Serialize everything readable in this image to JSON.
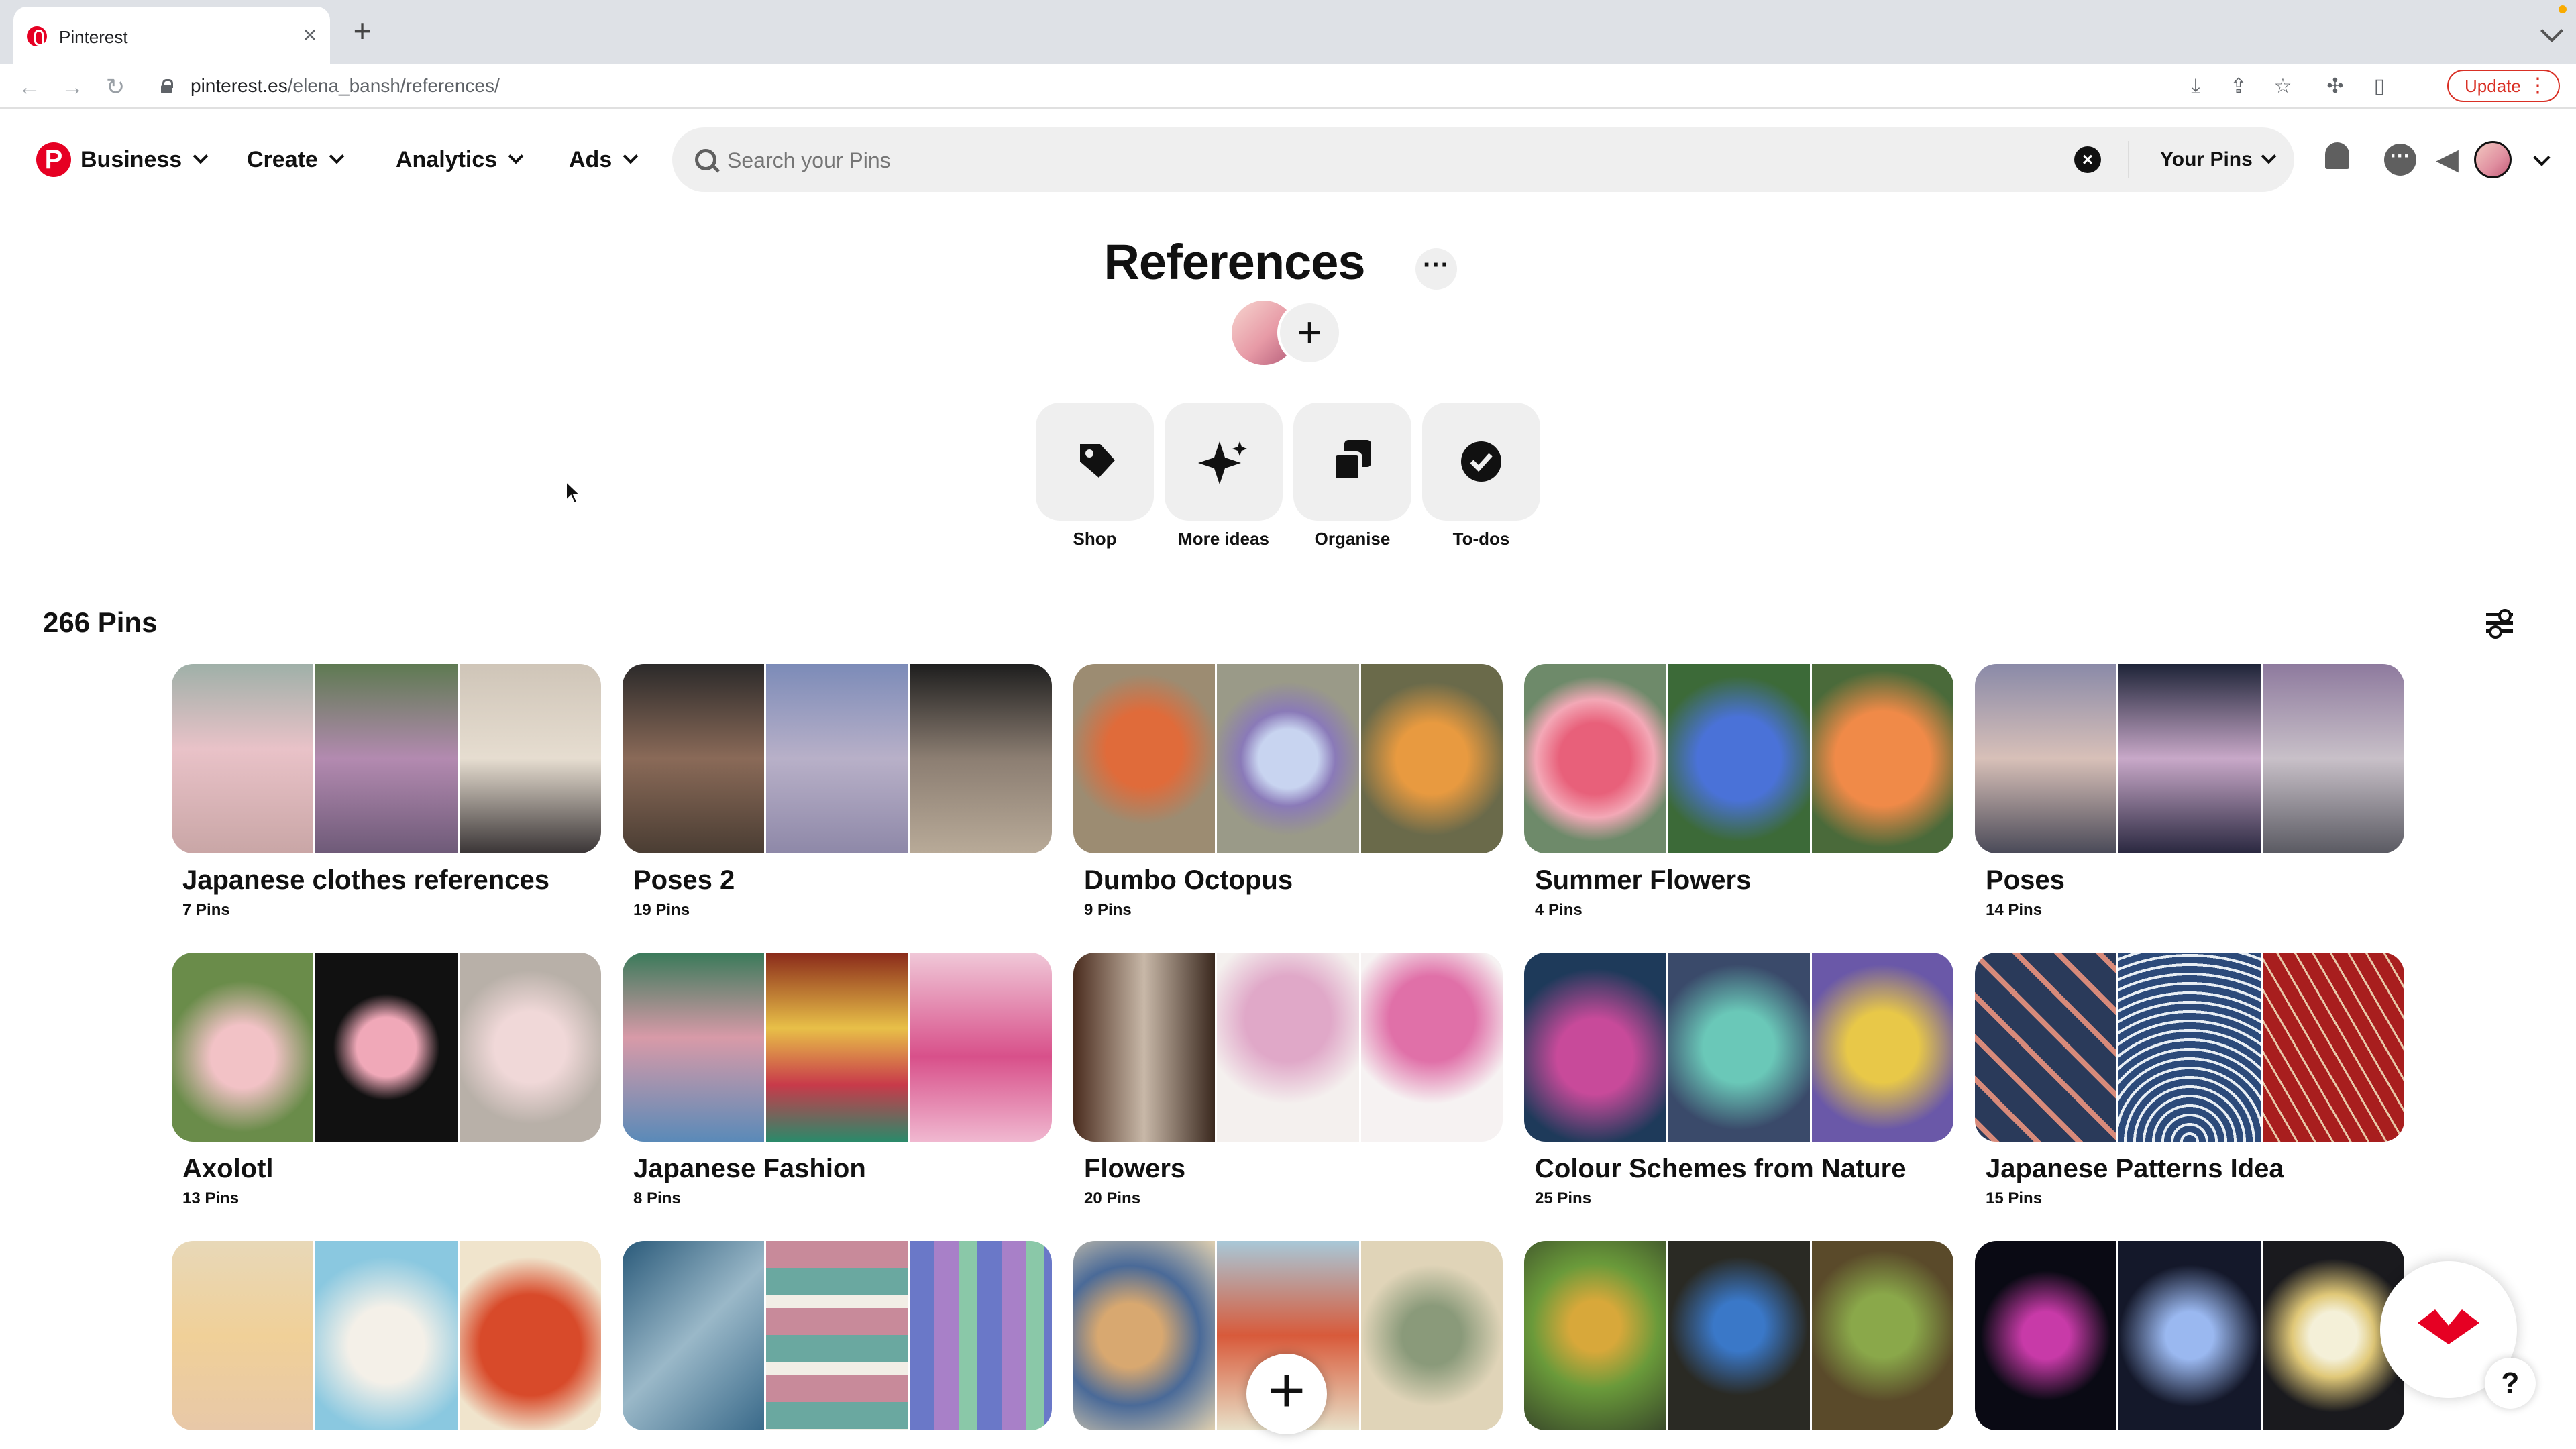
{
  "browser": {
    "tab_title": "Pinterest",
    "url_domain": "pinterest.es",
    "url_path": "/elena_bansh/references/",
    "update_label": "Update"
  },
  "header": {
    "nav": [
      "Business",
      "Create",
      "Analytics",
      "Ads"
    ],
    "search_placeholder": "Search your Pins",
    "your_pins_label": "Your Pins"
  },
  "board": {
    "title": "References",
    "actions": [
      {
        "label": "Shop",
        "icon": "tag-icon"
      },
      {
        "label": "More ideas",
        "icon": "sparkle-icon"
      },
      {
        "label": "Organise",
        "icon": "organise-icon"
      },
      {
        "label": "To-dos",
        "icon": "check-circle-icon"
      }
    ],
    "pins_count": "266 Pins"
  },
  "boards": [
    {
      "name": "Japanese clothes references",
      "count": "7 Pins"
    },
    {
      "name": "Poses 2",
      "count": "19 Pins"
    },
    {
      "name": "Dumbo Octopus",
      "count": "9 Pins"
    },
    {
      "name": "Summer Flowers",
      "count": "4 Pins"
    },
    {
      "name": "Poses",
      "count": "14 Pins"
    },
    {
      "name": "Axolotl",
      "count": "13 Pins"
    },
    {
      "name": "Japanese Fashion",
      "count": "8 Pins"
    },
    {
      "name": "Flowers",
      "count": "20 Pins"
    },
    {
      "name": "Colour Schemes from Nature",
      "count": "25 Pins"
    },
    {
      "name": "Japanese Patterns Idea",
      "count": "15 Pins"
    }
  ],
  "colors": {
    "brand": "#e60023",
    "chip_bg": "#efefef"
  }
}
